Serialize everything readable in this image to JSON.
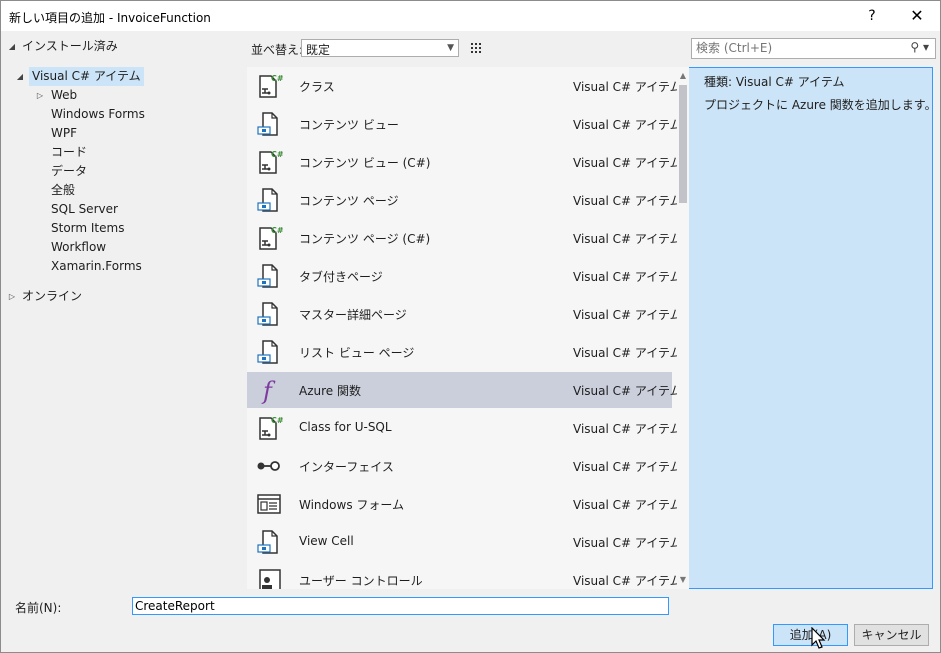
{
  "window": {
    "title": "新しい項目の追加 - InvoiceFunction",
    "help_label": "?",
    "close_label": "✕"
  },
  "tree": {
    "installed": "インストール済み",
    "visual_csharp": "Visual C# アイテム",
    "children": [
      "Web",
      "Windows Forms",
      "WPF",
      "コード",
      "データ",
      "全般",
      "SQL Server",
      "Storm Items",
      "Workflow",
      "Xamarin.Forms"
    ],
    "online": "オンライン"
  },
  "toolbar": {
    "sort_label": "並べ替え:",
    "sort_value": "既定",
    "search_placeholder": "検索 (Ctrl+E)"
  },
  "items": [
    {
      "name": "クラス",
      "type": "Visual C# アイテム",
      "icon": "csharp-class-icon"
    },
    {
      "name": "コンテンツ ビュー",
      "type": "Visual C# アイテム",
      "icon": "xaml-page-icon"
    },
    {
      "name": "コンテンツ ビュー (C#)",
      "type": "Visual C# アイテム",
      "icon": "csharp-class-icon"
    },
    {
      "name": "コンテンツ ページ",
      "type": "Visual C# アイテム",
      "icon": "xaml-page-icon"
    },
    {
      "name": "コンテンツ ページ (C#)",
      "type": "Visual C# アイテム",
      "icon": "csharp-class-icon"
    },
    {
      "name": "タブ付きページ",
      "type": "Visual C# アイテム",
      "icon": "xaml-page-icon"
    },
    {
      "name": "マスター詳細ページ",
      "type": "Visual C# アイテム",
      "icon": "xaml-page-icon"
    },
    {
      "name": "リスト ビュー ページ",
      "type": "Visual C# アイテム",
      "icon": "xaml-page-icon"
    },
    {
      "name": "Azure 関数",
      "type": "Visual C# アイテム",
      "icon": "azure-function-icon"
    },
    {
      "name": "Class for U-SQL",
      "type": "Visual C# アイテム",
      "icon": "csharp-class-icon"
    },
    {
      "name": "インターフェイス",
      "type": "Visual C# アイテム",
      "icon": "interface-icon"
    },
    {
      "name": "Windows フォーム",
      "type": "Visual C# アイテム",
      "icon": "windows-form-icon"
    },
    {
      "name": "View Cell",
      "type": "Visual C# アイテム",
      "icon": "xaml-page-icon"
    },
    {
      "name": "ユーザー コントロール",
      "type": "Visual C# アイテム",
      "icon": "user-control-icon"
    }
  ],
  "selected_index": 8,
  "info": {
    "type_line": "種類:  Visual C# アイテム",
    "description": "プロジェクトに Azure 関数を追加します。"
  },
  "footer": {
    "name_label": "名前(N):",
    "name_value": "CreateReport",
    "add_label": "追加(A)",
    "cancel_label": "キャンセル"
  },
  "colors": {
    "csharp_green": "#388a34",
    "xaml_blue": "#1e73be",
    "function_purple": "#7e3b9e",
    "selection": "#cbcfdc"
  }
}
